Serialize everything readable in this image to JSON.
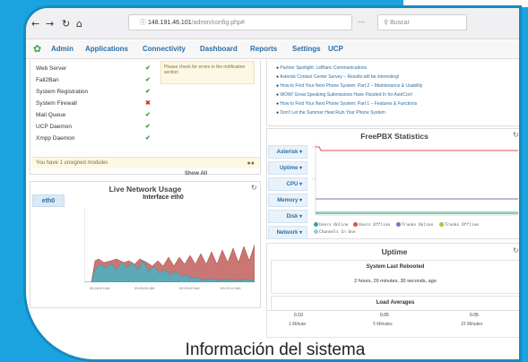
{
  "caption": "Información del sistema",
  "browser": {
    "back_icon": "back-arrow-icon",
    "forward_icon": "forward-arrow-icon",
    "reload_icon": "reload-icon",
    "home_icon": "home-icon",
    "url_host": "148.191.46.101",
    "url_path": "/admin/config.php#",
    "search_placeholder": "Buscar"
  },
  "menu": {
    "items": [
      "Admin",
      "Applications",
      "Connectivity",
      "Dashboard",
      "Reports",
      "Settings",
      "UCP"
    ]
  },
  "services": {
    "rows": [
      {
        "name": "Web Server",
        "status": "ok"
      },
      {
        "name": "Fail2Ban",
        "status": "ok"
      },
      {
        "name": "System Registration",
        "status": "ok"
      },
      {
        "name": "System Firewall",
        "status": "bad"
      },
      {
        "name": "Mail Queue",
        "status": "ok"
      },
      {
        "name": "UCP Daemon",
        "status": "ok"
      },
      {
        "name": "Xmpp Daemon",
        "status": "ok"
      }
    ],
    "notice": "Please check for errors in the notification section",
    "unsigned": "You have 1 unsigned modules",
    "show_all": "Show All"
  },
  "news": {
    "items": [
      "Partner Spotlight: LeBlanc Communications",
      "Asterisk Contact Center Survey – Results will be interesting!",
      "How to Find Your Next Phone System: Part 2 – Maintenance & Usability",
      "WOW! Great Speaking Submissions Have Flooded In for AstriCon!",
      "How to Find Your Next Phone System: Part 1 – Features & Functions",
      "Don't Let the Summer Heat Ruin Your Phone System"
    ]
  },
  "stats": {
    "title": "FreePBX Statistics",
    "tabs": [
      "Asterisk",
      "Uptime",
      "CPU",
      "Memory",
      "Disk",
      "Network"
    ],
    "legend": [
      {
        "label": "Users Online",
        "color": "#3aa0a0"
      },
      {
        "label": "Users Offline",
        "color": "#d9534f"
      },
      {
        "label": "Trunks Online",
        "color": "#8e6bbf"
      },
      {
        "label": "Trunks Offline",
        "color": "#a6c832"
      },
      {
        "label": "Channels In Use",
        "color": "#9ac7e8"
      }
    ]
  },
  "network": {
    "title": "Live Network Usage",
    "tab": "eth0",
    "chart_title": "Interface eth0",
    "ticks": [
      "09:28:40 AM",
      "09:28:50 AM",
      "09:29:00 AM",
      "09:29:10 AM"
    ]
  },
  "uptime": {
    "title": "Uptime",
    "rebooted_label": "System Last Rebooted",
    "rebooted_value": "2 hours, 26 minutes, 30 seconds, ago",
    "load_label": "Load Averages",
    "loads": [
      {
        "value": "0.10",
        "period": "1 Minute"
      },
      {
        "value": "0.05",
        "period": "5 Minutes"
      },
      {
        "value": "0.05",
        "period": "15 Minutes"
      }
    ]
  }
}
